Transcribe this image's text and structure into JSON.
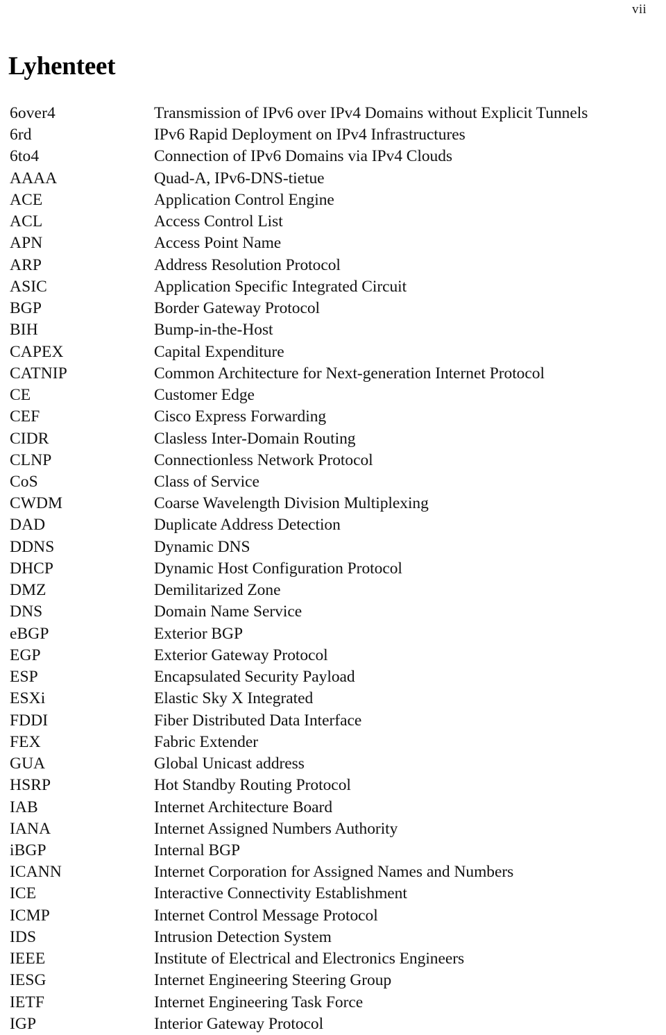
{
  "page": {
    "folio": "vii",
    "title": "Lyhenteet"
  },
  "abbreviations": [
    {
      "term": "6over4",
      "definition": "Transmission of IPv6 over IPv4 Domains without Explicit Tunnels"
    },
    {
      "term": "6rd",
      "definition": "IPv6 Rapid Deployment on IPv4 Infrastructures"
    },
    {
      "term": "6to4",
      "definition": "Connection of IPv6 Domains via IPv4 Clouds"
    },
    {
      "term": "AAAA",
      "definition": "Quad-A, IPv6-DNS-tietue"
    },
    {
      "term": "ACE",
      "definition": "Application Control Engine"
    },
    {
      "term": "ACL",
      "definition": "Access Control List"
    },
    {
      "term": "APN",
      "definition": "Access Point Name"
    },
    {
      "term": "ARP",
      "definition": "Address Resolution Protocol"
    },
    {
      "term": "ASIC",
      "definition": "Application Specific Integrated Circuit"
    },
    {
      "term": "BGP",
      "definition": "Border Gateway Protocol"
    },
    {
      "term": "BIH",
      "definition": "Bump-in-the-Host"
    },
    {
      "term": "CAPEX",
      "definition": "Capital Expenditure"
    },
    {
      "term": "CATNIP",
      "definition": "Common Architecture for Next-generation Internet Protocol"
    },
    {
      "term": "CE",
      "definition": "Customer Edge"
    },
    {
      "term": "CEF",
      "definition": "Cisco Express Forwarding"
    },
    {
      "term": "CIDR",
      "definition": "Clasless Inter-Domain Routing"
    },
    {
      "term": "CLNP",
      "definition": "Connectionless Network Protocol"
    },
    {
      "term": "CoS",
      "definition": "Class of Service"
    },
    {
      "term": "CWDM",
      "definition": "Coarse Wavelength Division Multiplexing"
    },
    {
      "term": "DAD",
      "definition": "Duplicate Address Detection"
    },
    {
      "term": "DDNS",
      "definition": "Dynamic DNS"
    },
    {
      "term": "DHCP",
      "definition": "Dynamic Host Configuration Protocol"
    },
    {
      "term": "DMZ",
      "definition": "Demilitarized Zone"
    },
    {
      "term": "DNS",
      "definition": "Domain Name Service"
    },
    {
      "term": "eBGP",
      "definition": "Exterior BGP"
    },
    {
      "term": "EGP",
      "definition": "Exterior Gateway Protocol"
    },
    {
      "term": "ESP",
      "definition": "Encapsulated Security Payload"
    },
    {
      "term": "ESXi",
      "definition": "Elastic Sky X Integrated"
    },
    {
      "term": "FDDI",
      "definition": "Fiber Distributed Data Interface"
    },
    {
      "term": "FEX",
      "definition": "Fabric Extender"
    },
    {
      "term": "GUA",
      "definition": "Global Unicast address"
    },
    {
      "term": "HSRP",
      "definition": "Hot Standby Routing Protocol"
    },
    {
      "term": "IAB",
      "definition": "Internet Architecture Board"
    },
    {
      "term": "IANA",
      "definition": "Internet Assigned Numbers Authority"
    },
    {
      "term": "iBGP",
      "definition": "Internal BGP"
    },
    {
      "term": "ICANN",
      "definition": "Internet Corporation for Assigned Names and Numbers"
    },
    {
      "term": "ICE",
      "definition": "Interactive Connectivity Establishment"
    },
    {
      "term": "ICMP",
      "definition": "Internet Control Message Protocol"
    },
    {
      "term": "IDS",
      "definition": "Intrusion Detection System"
    },
    {
      "term": "IEEE",
      "definition": "Institute of Electrical and Electronics Engineers"
    },
    {
      "term": "IESG",
      "definition": "Internet Engineering Steering Group"
    },
    {
      "term": "IETF",
      "definition": "Internet Engineering Task Force"
    },
    {
      "term": "IGP",
      "definition": "Interior Gateway Protocol"
    }
  ]
}
